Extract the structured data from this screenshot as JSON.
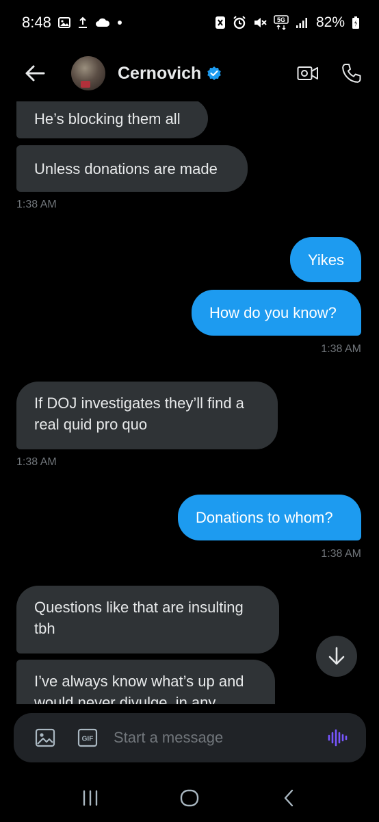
{
  "status_bar": {
    "time": "8:48",
    "battery": "82%",
    "icons": [
      "image-icon",
      "upload-icon",
      "cloud-icon",
      "dot-icon",
      "nfc-icon",
      "alarm-icon",
      "mute-icon",
      "5g-icon",
      "signal-icon",
      "battery-icon"
    ],
    "network": "5G"
  },
  "header": {
    "contact_name": "Cernovich",
    "verified": true,
    "accent_color": "#1d9bf0"
  },
  "messages": [
    {
      "direction": "in",
      "text": "He’s blocking them all"
    },
    {
      "direction": "in",
      "text": "Unless donations are made"
    },
    {
      "type": "timestamp",
      "align": "left",
      "text": "1:38 AM"
    },
    {
      "direction": "out",
      "text": "Yikes"
    },
    {
      "direction": "out",
      "text": "How do you know?"
    },
    {
      "type": "timestamp",
      "align": "right",
      "text": "1:38 AM"
    },
    {
      "direction": "in",
      "text": "If DOJ investigates they’ll find a real quid pro quo"
    },
    {
      "type": "timestamp",
      "align": "left",
      "text": "1:38 AM"
    },
    {
      "direction": "out",
      "text": "Donations to whom?"
    },
    {
      "type": "timestamp",
      "align": "right",
      "text": "1:38 AM"
    },
    {
      "direction": "in",
      "text": "Questions like that are insulting tbh"
    },
    {
      "direction": "in",
      "text": "I’ve always know what’s up and would never divulge, in any"
    }
  ],
  "composer": {
    "placeholder": "Start a message",
    "gif_label": "GIF"
  },
  "colors": {
    "background": "#000000",
    "incoming_bubble": "#2f3336",
    "outgoing_bubble": "#1d9bf0",
    "timestamp": "#71767b",
    "voice_accent": "#7856ff"
  }
}
